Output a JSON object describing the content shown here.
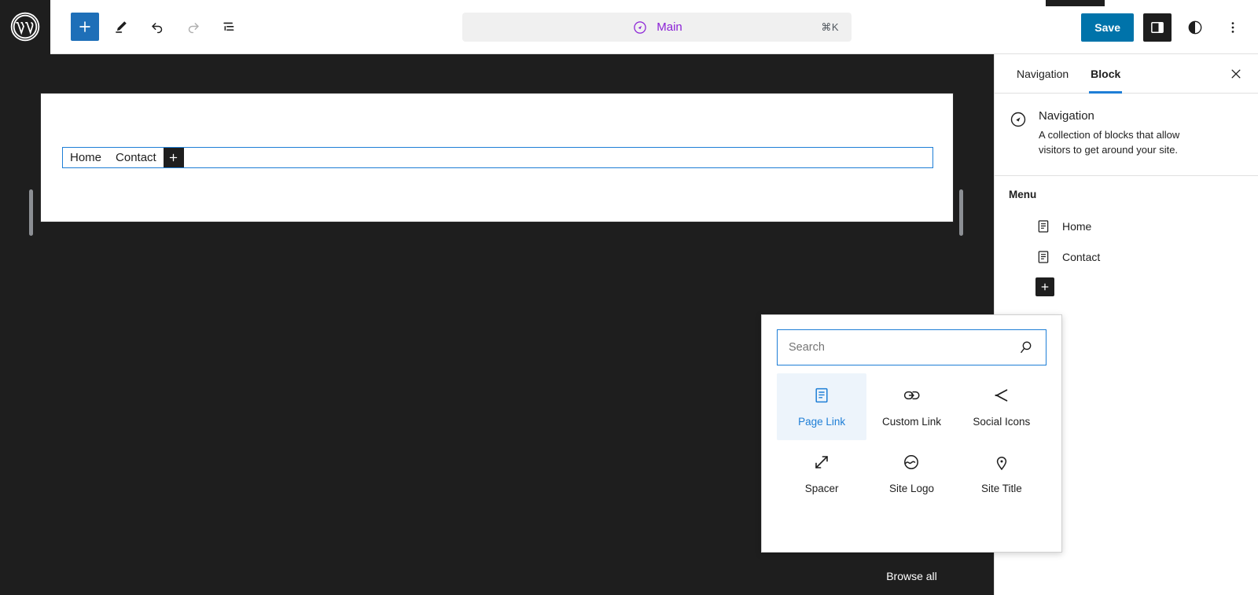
{
  "header": {
    "logo_icon": "wordpress-logo-icon",
    "tools": [
      {
        "name": "add-block-button",
        "icon": "plus-icon",
        "label": "Add block"
      },
      {
        "name": "edit-tool-button",
        "icon": "pencil-icon",
        "label": "Edit"
      },
      {
        "name": "undo-button",
        "icon": "undo-arrow-icon",
        "label": "Undo"
      },
      {
        "name": "redo-button",
        "icon": "redo-arrow-icon",
        "label": "Redo"
      },
      {
        "name": "list-view-button",
        "icon": "list-view-icon",
        "label": "List View"
      }
    ],
    "command_bar": {
      "icon": "navigation-compass-icon",
      "title": "Main",
      "shortcut": "⌘K"
    },
    "save_label": "Save",
    "sidebar_toggle_icon": "sidebar-panel-icon",
    "styles_icon": "contrast-half-circle-icon",
    "options_icon": "three-dots-vertical-icon"
  },
  "canvas": {
    "navigation_block": {
      "items": [
        {
          "label": "Home"
        },
        {
          "label": "Contact"
        }
      ],
      "add_icon": "plus-icon"
    },
    "resize_handle_left": "resize-handle-left",
    "resize_handle_right": "resize-handle-right"
  },
  "sidebar": {
    "tabs": [
      {
        "label": "Navigation",
        "active": false
      },
      {
        "label": "Block",
        "active": true
      }
    ],
    "close_icon": "close-x-icon",
    "block_info": {
      "icon": "navigation-compass-icon",
      "title": "Navigation",
      "description": "A collection of blocks that allow visitors to get around your site."
    },
    "menu": {
      "title": "Menu",
      "items": [
        {
          "label": "Home",
          "icon": "page-document-icon"
        },
        {
          "label": "Contact",
          "icon": "page-document-icon"
        }
      ],
      "add_icon": "plus-icon"
    }
  },
  "inserter": {
    "search": {
      "placeholder": "Search",
      "value": "",
      "icon": "search-magnifier-icon"
    },
    "blocks": [
      {
        "label": "Page Link",
        "icon": "page-document-icon",
        "selected": true
      },
      {
        "label": "Custom Link",
        "icon": "custom-link-icon",
        "selected": false
      },
      {
        "label": "Social Icons",
        "icon": "share-social-icon",
        "selected": false
      },
      {
        "label": "Spacer",
        "icon": "spacer-arrows-icon",
        "selected": false
      },
      {
        "label": "Site Logo",
        "icon": "site-logo-circle-icon",
        "selected": false
      },
      {
        "label": "Site Title",
        "icon": "map-pin-icon",
        "selected": false
      }
    ],
    "browse_all_label": "Browse all"
  },
  "colors": {
    "accent_blue": "#1e7ed6",
    "save_blue": "#0073aa",
    "command_purple": "#8b21d6",
    "dark": "#1e1e1e"
  }
}
